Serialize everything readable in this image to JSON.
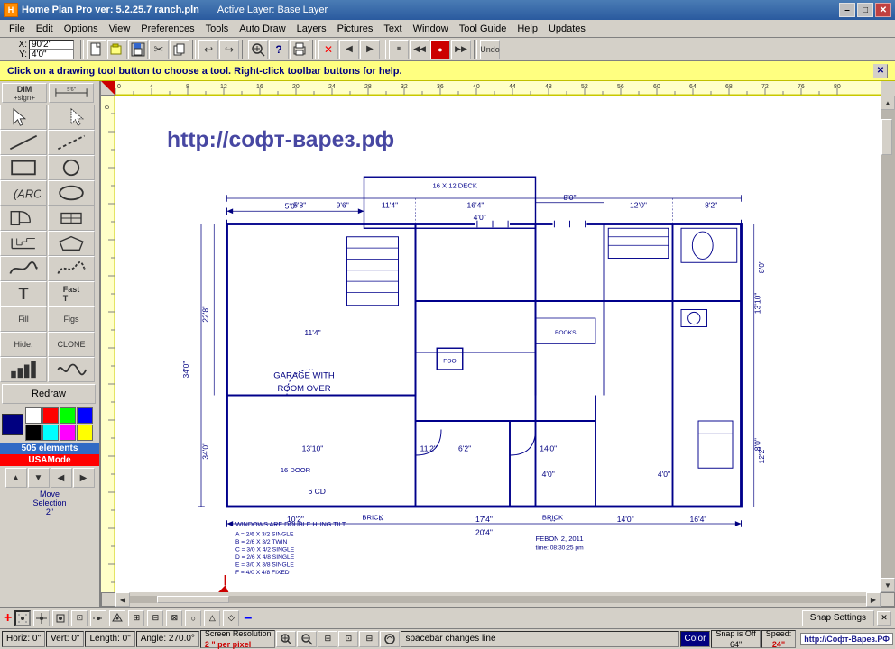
{
  "titlebar": {
    "title": "Home Plan Pro ver: 5.2.25.7    ranch.pln",
    "active_layer": "Active Layer: Base Layer",
    "min_label": "–",
    "max_label": "□",
    "close_label": "✕"
  },
  "menubar": {
    "items": [
      "File",
      "Edit",
      "Options",
      "View",
      "Preferences",
      "Tools",
      "Auto Draw",
      "Layers",
      "Pictures",
      "Text",
      "Window",
      "Tool Guide",
      "Help",
      "Updates"
    ]
  },
  "toolbar": {
    "coord_x_label": "X: 90'2\"",
    "coord_y_label": "Y: 4'0\"",
    "buttons": [
      "📁",
      "💾",
      "✂",
      "📋",
      "↩",
      "↪",
      "🔍",
      "❓",
      "⬛",
      "✕",
      "◀",
      "▶",
      "⏸",
      "◀◀",
      "⏺",
      "▶▶"
    ]
  },
  "infobar": {
    "message": "Click on a drawing tool button to choose a tool.  Right-click toolbar buttons for help.",
    "close": "✕"
  },
  "left_panel": {
    "dim_label": "DIM",
    "dim_sign": "+sign+",
    "elements_count": "505 elements",
    "usa_mode": "USAMode",
    "redraw": "Redraw",
    "move_sel_label": "Move\nSelection\n2\"",
    "tool_buttons": [
      {
        "id": "select",
        "icon": "↖",
        "label": "Select"
      },
      {
        "id": "select2",
        "icon": "⬚",
        "label": "Select2"
      },
      {
        "id": "line",
        "icon": "╱",
        "label": "Line"
      },
      {
        "id": "dash",
        "icon": "╌",
        "label": "Dash"
      },
      {
        "id": "rect",
        "icon": "▭",
        "label": "Rect"
      },
      {
        "id": "circle_sq",
        "icon": "○",
        "label": "CircleSq"
      },
      {
        "id": "arc",
        "icon": "⌒",
        "label": "Arc"
      },
      {
        "id": "ellipse",
        "icon": "⬭",
        "label": "Ellipse"
      },
      {
        "id": "door",
        "icon": "🚪",
        "label": "Door"
      },
      {
        "id": "window",
        "icon": "⬜",
        "label": "Window"
      },
      {
        "id": "stair",
        "icon": "≡",
        "label": "Stair"
      },
      {
        "id": "poly",
        "icon": "⬡",
        "label": "Poly"
      },
      {
        "id": "spline",
        "icon": "∿",
        "label": "Spline"
      },
      {
        "id": "spline2",
        "icon": "〜",
        "label": "Spline2"
      },
      {
        "id": "text",
        "icon": "T",
        "label": "Text"
      },
      {
        "id": "fast_text",
        "icon": "Fast T",
        "label": "FastText"
      },
      {
        "id": "fill",
        "icon": "Fill",
        "label": "Fill"
      },
      {
        "id": "figs",
        "icon": "Figs",
        "label": "Figs"
      },
      {
        "id": "hide",
        "icon": "Hide",
        "label": "Hide"
      },
      {
        "id": "clone",
        "icon": "Clone",
        "label": "Clone"
      },
      {
        "id": "chart",
        "icon": "📊",
        "label": "Chart"
      },
      {
        "id": "wave",
        "icon": "∿",
        "label": "Wave"
      }
    ]
  },
  "snap_bar": {
    "plus": "+",
    "minus": "–",
    "snap_btns": [
      "⊞",
      "⊟",
      "⊠",
      "⊡",
      "⊞",
      "⊟",
      "⊠",
      "⊡",
      "⊞",
      "⊟",
      "⊠",
      "⊡"
    ],
    "snap_settings": "Snap Settings"
  },
  "status_bar": {
    "horiz": "Horiz: 0\"",
    "vert": "Vert:  0\"",
    "length": "Length:  0\"",
    "angle": "Angle:  270.0°",
    "screen_res": "Screen Resolution",
    "per_pixel": "2 \" per pixel",
    "hint": "spacebar changes line",
    "color_label": "Color",
    "snap_off": "Snap is Off",
    "snap_val": "64\"",
    "speed_label": "Speed:",
    "speed_val": "24\"",
    "zoom_btns": [
      "🔍+",
      "🔍-"
    ],
    "watermark": "http://Софт-Варез.РФ"
  },
  "drawing": {
    "watermark": "http://софт-варез.рф",
    "windows_note": "WINDOWS ARE DOUBLE HUNG TILT",
    "window_list": [
      "A = 2/6 X 3/2 SINGLE",
      "B = 2/6 X 3/2 TWIN",
      "C = 3/0 X 4/2 SINGLE",
      "D = 2/6 X 4/8 SINGLE",
      "E = 3/0 X 3/8 SINGLE",
      "F = 4/0 X 4/8 FIXED"
    ],
    "date_text": "FEBON 2, 2011",
    "time_text": "time: 08:30:25 pm",
    "garage_label": "GARAGE WITH\nROOM OVER",
    "brick_label1": "BRICK",
    "brick_label2": "BRICK",
    "deck_label": "16 X 12 DECK"
  },
  "colors": {
    "accent": "#000080",
    "yellow_bar": "#ffff80",
    "ruler_bg": "#ffffc8",
    "drawing_bg": "#ffffff",
    "wall_color": "#00008B",
    "dim_color": "#000080"
  }
}
